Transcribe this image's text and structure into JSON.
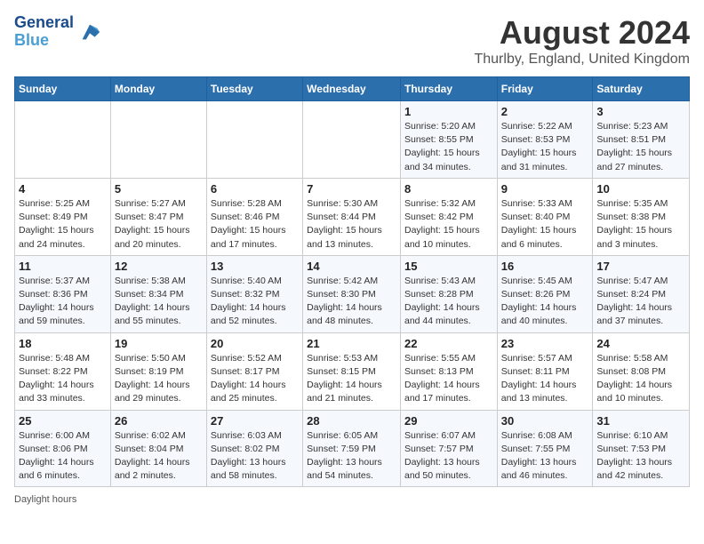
{
  "header": {
    "logo_line1": "General",
    "logo_line2": "Blue",
    "month_title": "August 2024",
    "location": "Thurlby, England, United Kingdom"
  },
  "days_of_week": [
    "Sunday",
    "Monday",
    "Tuesday",
    "Wednesday",
    "Thursday",
    "Friday",
    "Saturday"
  ],
  "weeks": [
    [
      {
        "num": "",
        "info": ""
      },
      {
        "num": "",
        "info": ""
      },
      {
        "num": "",
        "info": ""
      },
      {
        "num": "",
        "info": ""
      },
      {
        "num": "1",
        "info": "Sunrise: 5:20 AM\nSunset: 8:55 PM\nDaylight: 15 hours and 34 minutes."
      },
      {
        "num": "2",
        "info": "Sunrise: 5:22 AM\nSunset: 8:53 PM\nDaylight: 15 hours and 31 minutes."
      },
      {
        "num": "3",
        "info": "Sunrise: 5:23 AM\nSunset: 8:51 PM\nDaylight: 15 hours and 27 minutes."
      }
    ],
    [
      {
        "num": "4",
        "info": "Sunrise: 5:25 AM\nSunset: 8:49 PM\nDaylight: 15 hours and 24 minutes."
      },
      {
        "num": "5",
        "info": "Sunrise: 5:27 AM\nSunset: 8:47 PM\nDaylight: 15 hours and 20 minutes."
      },
      {
        "num": "6",
        "info": "Sunrise: 5:28 AM\nSunset: 8:46 PM\nDaylight: 15 hours and 17 minutes."
      },
      {
        "num": "7",
        "info": "Sunrise: 5:30 AM\nSunset: 8:44 PM\nDaylight: 15 hours and 13 minutes."
      },
      {
        "num": "8",
        "info": "Sunrise: 5:32 AM\nSunset: 8:42 PM\nDaylight: 15 hours and 10 minutes."
      },
      {
        "num": "9",
        "info": "Sunrise: 5:33 AM\nSunset: 8:40 PM\nDaylight: 15 hours and 6 minutes."
      },
      {
        "num": "10",
        "info": "Sunrise: 5:35 AM\nSunset: 8:38 PM\nDaylight: 15 hours and 3 minutes."
      }
    ],
    [
      {
        "num": "11",
        "info": "Sunrise: 5:37 AM\nSunset: 8:36 PM\nDaylight: 14 hours and 59 minutes."
      },
      {
        "num": "12",
        "info": "Sunrise: 5:38 AM\nSunset: 8:34 PM\nDaylight: 14 hours and 55 minutes."
      },
      {
        "num": "13",
        "info": "Sunrise: 5:40 AM\nSunset: 8:32 PM\nDaylight: 14 hours and 52 minutes."
      },
      {
        "num": "14",
        "info": "Sunrise: 5:42 AM\nSunset: 8:30 PM\nDaylight: 14 hours and 48 minutes."
      },
      {
        "num": "15",
        "info": "Sunrise: 5:43 AM\nSunset: 8:28 PM\nDaylight: 14 hours and 44 minutes."
      },
      {
        "num": "16",
        "info": "Sunrise: 5:45 AM\nSunset: 8:26 PM\nDaylight: 14 hours and 40 minutes."
      },
      {
        "num": "17",
        "info": "Sunrise: 5:47 AM\nSunset: 8:24 PM\nDaylight: 14 hours and 37 minutes."
      }
    ],
    [
      {
        "num": "18",
        "info": "Sunrise: 5:48 AM\nSunset: 8:22 PM\nDaylight: 14 hours and 33 minutes."
      },
      {
        "num": "19",
        "info": "Sunrise: 5:50 AM\nSunset: 8:19 PM\nDaylight: 14 hours and 29 minutes."
      },
      {
        "num": "20",
        "info": "Sunrise: 5:52 AM\nSunset: 8:17 PM\nDaylight: 14 hours and 25 minutes."
      },
      {
        "num": "21",
        "info": "Sunrise: 5:53 AM\nSunset: 8:15 PM\nDaylight: 14 hours and 21 minutes."
      },
      {
        "num": "22",
        "info": "Sunrise: 5:55 AM\nSunset: 8:13 PM\nDaylight: 14 hours and 17 minutes."
      },
      {
        "num": "23",
        "info": "Sunrise: 5:57 AM\nSunset: 8:11 PM\nDaylight: 14 hours and 13 minutes."
      },
      {
        "num": "24",
        "info": "Sunrise: 5:58 AM\nSunset: 8:08 PM\nDaylight: 14 hours and 10 minutes."
      }
    ],
    [
      {
        "num": "25",
        "info": "Sunrise: 6:00 AM\nSunset: 8:06 PM\nDaylight: 14 hours and 6 minutes."
      },
      {
        "num": "26",
        "info": "Sunrise: 6:02 AM\nSunset: 8:04 PM\nDaylight: 14 hours and 2 minutes."
      },
      {
        "num": "27",
        "info": "Sunrise: 6:03 AM\nSunset: 8:02 PM\nDaylight: 13 hours and 58 minutes."
      },
      {
        "num": "28",
        "info": "Sunrise: 6:05 AM\nSunset: 7:59 PM\nDaylight: 13 hours and 54 minutes."
      },
      {
        "num": "29",
        "info": "Sunrise: 6:07 AM\nSunset: 7:57 PM\nDaylight: 13 hours and 50 minutes."
      },
      {
        "num": "30",
        "info": "Sunrise: 6:08 AM\nSunset: 7:55 PM\nDaylight: 13 hours and 46 minutes."
      },
      {
        "num": "31",
        "info": "Sunrise: 6:10 AM\nSunset: 7:53 PM\nDaylight: 13 hours and 42 minutes."
      }
    ]
  ],
  "footer": "Daylight hours"
}
